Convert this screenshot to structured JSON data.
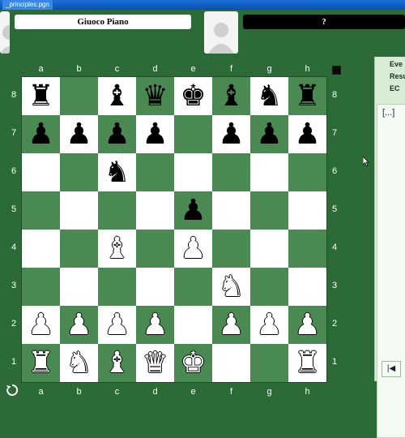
{
  "window": {
    "title": "_principles.pgn"
  },
  "players": {
    "top_left_name": "Giuoco Piano",
    "top_right_name": "?"
  },
  "board": {
    "files": [
      "a",
      "b",
      "c",
      "d",
      "e",
      "f",
      "g",
      "h"
    ],
    "ranks": [
      "8",
      "7",
      "6",
      "5",
      "4",
      "3",
      "2",
      "1"
    ],
    "light_color": "#ffffff",
    "dark_color": "#4a8a52",
    "position": [
      [
        "bR",
        "",
        "bB",
        "bQ",
        "bK",
        "bB",
        "bN",
        "bR"
      ],
      [
        "bP",
        "bP",
        "bP",
        "bP",
        "",
        "bP",
        "bP",
        "bP"
      ],
      [
        "",
        "",
        "bN",
        "",
        "",
        "",
        "",
        ""
      ],
      [
        "",
        "",
        "",
        "",
        "bP",
        "",
        "",
        ""
      ],
      [
        "",
        "",
        "wB",
        "",
        "wP",
        "",
        "",
        ""
      ],
      [
        "",
        "",
        "",
        "",
        "",
        "wN",
        "",
        ""
      ],
      [
        "wP",
        "wP",
        "wP",
        "wP",
        "",
        "wP",
        "wP",
        "wP"
      ],
      [
        "wR",
        "wN",
        "wB",
        "wQ",
        "wK",
        "",
        "",
        "wR"
      ]
    ]
  },
  "side_panel": {
    "header_lines": [
      "Eve",
      "Resu",
      "EC"
    ],
    "moves_text": "[...]",
    "first_button": "|◀"
  },
  "icons": {
    "rotate": "rotate-board-icon",
    "turn": "side-to-move-icon",
    "avatar": "player-avatar-icon"
  },
  "colors": {
    "background": "#2c6b37",
    "titlebar": "#0a4fb3"
  }
}
